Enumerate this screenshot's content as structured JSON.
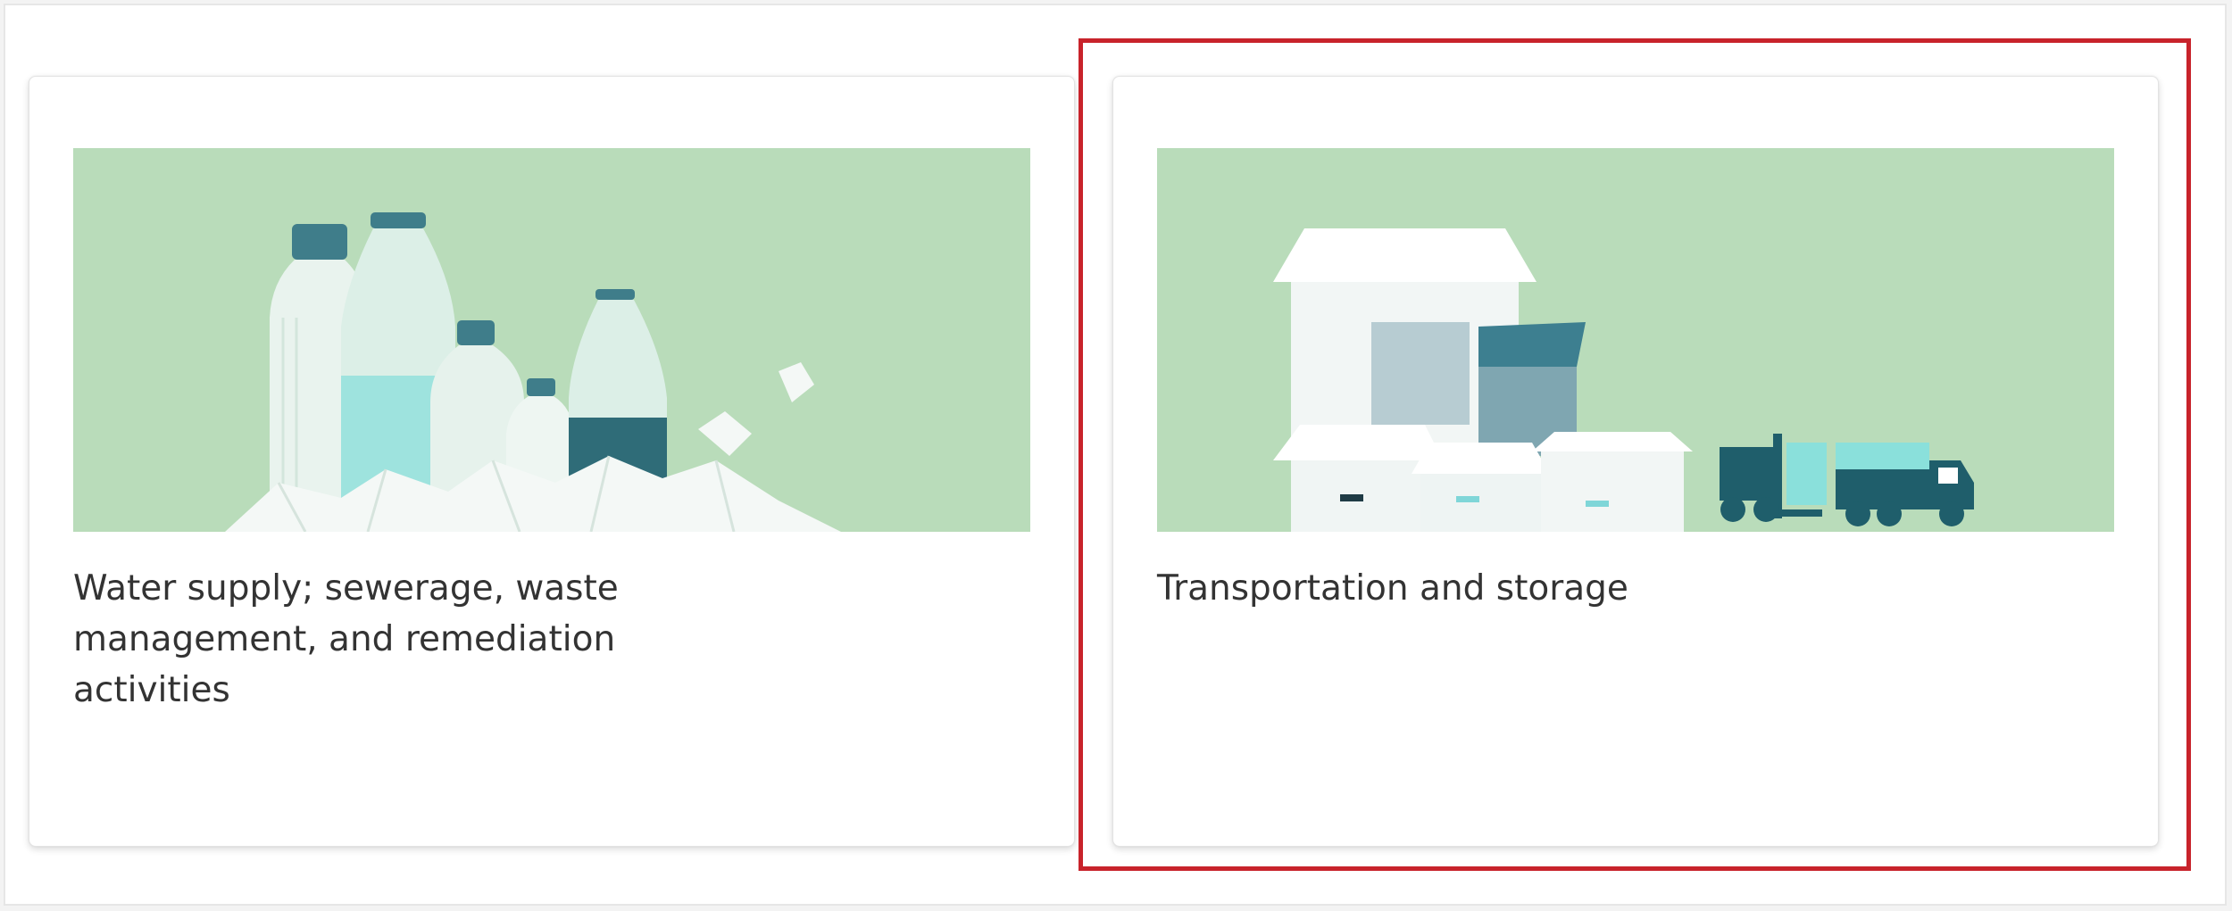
{
  "theme": {
    "image_bg": "#b9dcba",
    "highlight_color": "#c8232b",
    "title_color": "#333333"
  },
  "cards": [
    {
      "title": "Water supply; sewerage, waste management, and remediation activities",
      "image_icon": "plastic-bottles-illustration"
    },
    {
      "title": "Transportation and storage",
      "image_icon": "boxes-forklift-truck-illustration",
      "highlighted": true
    }
  ]
}
